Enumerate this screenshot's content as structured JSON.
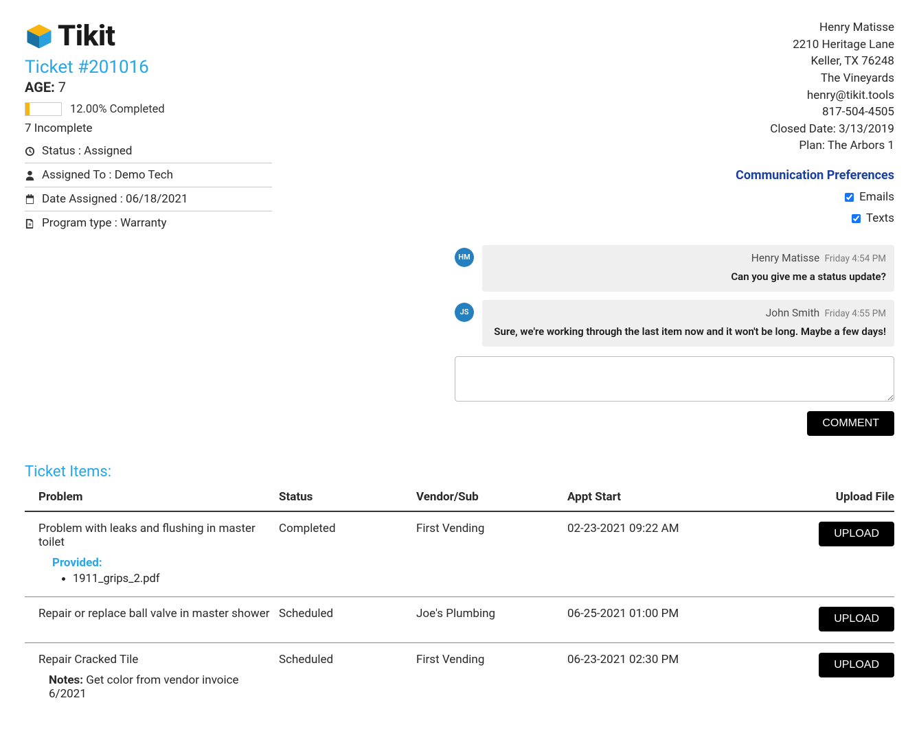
{
  "brand": "Tikit",
  "ticket": {
    "label_prefix": "Ticket #",
    "number": "201016",
    "age_label": "AGE:",
    "age_value": "7",
    "progress_pct": 12,
    "progress_text": "12.00% Completed",
    "incomplete_text": "7 Incomplete",
    "meta": {
      "status": "Status : Assigned",
      "assigned_to": "Assigned To : Demo Tech",
      "date_assigned": "Date Assigned : 06/18/2021",
      "program_type": "Program type : Warranty"
    }
  },
  "customer": {
    "name": "Henry Matisse",
    "address_line1": "2210 Heritage Lane",
    "address_line2": "Keller, TX 76248",
    "community": "The Vineyards",
    "email": "henry@tikit.tools",
    "phone": "817-504-4505",
    "closed_date": "Closed Date: 3/13/2019",
    "plan": "Plan: The Arbors 1"
  },
  "comm_prefs": {
    "title": "Communication Preferences",
    "emails_label": "Emails",
    "texts_label": "Texts"
  },
  "chat": {
    "messages": [
      {
        "initials": "HM",
        "author": "Henry Matisse",
        "ts": "Friday 4:54 PM",
        "body": "Can you give me a status update?"
      },
      {
        "initials": "JS",
        "author": "John Smith",
        "ts": "Friday 4:55 PM",
        "body": "Sure, we're working through the last item now and it won't be long. Maybe a few days!"
      }
    ],
    "comment_button": "COMMENT"
  },
  "items": {
    "section_title": "Ticket Items:",
    "columns": {
      "problem": "Problem",
      "status": "Status",
      "vendor": "Vendor/Sub",
      "appt": "Appt Start",
      "upload": "Upload File"
    },
    "upload_btn": "UPLOAD",
    "provided_label": "Provided:",
    "notes_label": "Notes:",
    "rows": [
      {
        "problem": "Problem with leaks and flushing in master toilet",
        "status": "Completed",
        "vendor": "First Vending",
        "appt": "02-23-2021 09:22 AM",
        "files": [
          "1911_grips_2.pdf"
        ]
      },
      {
        "problem": "Repair or replace ball valve in master shower",
        "status": "Scheduled",
        "vendor": "Joe's Plumbing",
        "appt": "06-25-2021 01:00 PM"
      },
      {
        "problem": "Repair Cracked Tile",
        "status": "Scheduled",
        "vendor": "First Vending",
        "appt": "06-23-2021 02:30 PM",
        "notes": "Get color from vendor invoice 6/2021"
      }
    ]
  }
}
